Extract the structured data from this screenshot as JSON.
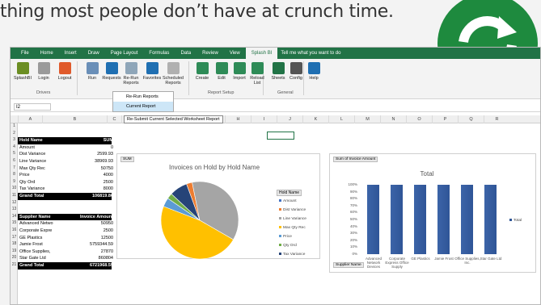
{
  "headline": "thing most people don’t have at crunch time.",
  "logo_icon": "refresh-arrows-icon",
  "ribbon": {
    "tabs": [
      "File",
      "Home",
      "Insert",
      "Draw",
      "Page Layout",
      "Formulas",
      "Data",
      "Review",
      "View",
      "Splash BI"
    ],
    "active_tab": "Splash BI",
    "tell_me": "Tell me what you want to do",
    "buttons": [
      {
        "label": "SplashBI",
        "icon": "splash-icon",
        "color": "#6b8e23"
      },
      {
        "label": "Login",
        "icon": "login-icon",
        "color": "#9a9a9a"
      },
      {
        "label": "Logout",
        "icon": "logout-icon",
        "color": "#e05a2b"
      },
      {
        "label": "Run",
        "icon": "run-icon",
        "color": "#6a8fb8"
      },
      {
        "label": "Requests",
        "icon": "requests-icon",
        "color": "#1f6fb2"
      },
      {
        "label": "Re-Run Reports",
        "icon": "rerun-icon",
        "color": "#8fa6b9"
      },
      {
        "label": "Favorites",
        "icon": "star-icon",
        "color": "#1f6fb2"
      },
      {
        "label": "Scheduled Reports",
        "icon": "calendar-icon",
        "color": "#b0b0b0"
      },
      {
        "label": "Create",
        "icon": "create-icon",
        "color": "#2e8b57"
      },
      {
        "label": "Edit",
        "icon": "edit-icon",
        "color": "#2e8b57"
      },
      {
        "label": "Import",
        "icon": "import-icon",
        "color": "#2e8b57"
      },
      {
        "label": "Reload List",
        "icon": "reload-icon",
        "color": "#2e8b57"
      },
      {
        "label": "Sheets",
        "icon": "sheets-icon",
        "color": "#217346"
      },
      {
        "label": "Config",
        "icon": "config-icon",
        "color": "#555555"
      },
      {
        "label": "Help",
        "icon": "help-icon",
        "color": "#1f6fb2"
      }
    ],
    "groups": [
      "Drivers",
      "Report Setup",
      "General"
    ]
  },
  "dropdown": {
    "items": [
      "Re-Run Reports",
      "Current Report"
    ],
    "selected": "Current Report"
  },
  "tooltip": "Re-Submit Current Selected Worksheet Report",
  "namebox": "I2",
  "columns": [
    "A",
    "B",
    "C",
    "D",
    "E",
    "F",
    "G",
    "H",
    "I",
    "J",
    "K",
    "L",
    "M",
    "N",
    "O",
    "P",
    "Q",
    "R"
  ],
  "rows": [
    "1",
    "2",
    "3",
    "4",
    "5",
    "6",
    "7",
    "8",
    "9",
    "10",
    "11",
    "12",
    "13",
    "14",
    "15",
    "16",
    "17",
    "18",
    "19",
    "20",
    "21"
  ],
  "table1": {
    "header": [
      "Hold Name",
      "SUM"
    ],
    "rows": [
      [
        "Amount",
        "0"
      ],
      [
        "Dist Variance",
        "2599.93"
      ],
      [
        "Line Variance",
        "38969.93"
      ],
      [
        "Max Qty Rec",
        "50750"
      ],
      [
        "Price",
        "4000"
      ],
      [
        "Qty Ord",
        "2500"
      ],
      [
        "Tax Variance",
        "8000"
      ]
    ],
    "total": [
      "Grand Total",
      "106819.86"
    ]
  },
  "table2": {
    "header": [
      "Supplier Name",
      "Invoice Amount"
    ],
    "rows": [
      [
        "Advanced Netwo",
        "50950"
      ],
      [
        "Corporate Expre",
        "2500"
      ],
      [
        "GE Plastics",
        "12500"
      ],
      [
        "Jamie Frost",
        "5759344.59"
      ],
      [
        "Office Supplies,",
        "27870"
      ],
      [
        "Star Gate Ltd",
        "860804"
      ]
    ],
    "total": [
      "Grand Total",
      "6721968.59"
    ]
  },
  "pie": {
    "field_tag": "SUM",
    "legend_header": "Hold Name",
    "chart_data": {
      "type": "pie",
      "title": "Invoices on Hold by Hold Name",
      "categories": [
        "Amount",
        "Dist Variance",
        "Line Variance",
        "Max Qty Rec",
        "Price",
        "Qty Ord",
        "Tax Variance"
      ],
      "values": [
        0,
        2599.93,
        38969.93,
        50750,
        4000,
        2500,
        8000
      ],
      "colors": [
        "#4472c4",
        "#ed7d31",
        "#a5a5a5",
        "#ffc000",
        "#5b9bd5",
        "#70ad47",
        "#264478"
      ]
    }
  },
  "bar": {
    "field_tag": "Sum of Invoice Amount",
    "axis_tag": "Supplier Name",
    "legend": "Total",
    "chart_data": {
      "type": "bar",
      "title": "Total",
      "categories": [
        "Advanced Network Devices",
        "Corporate Express Office Supply",
        "GE Plastics",
        "Jamie Frost",
        "Office Supplies, Inc.",
        "Star Gate Ltd"
      ],
      "values": [
        1.0,
        1.0,
        1.0,
        1.0,
        1.0,
        1.0
      ],
      "yticks": [
        "100%",
        "90%",
        "80%",
        "70%",
        "60%",
        "50%",
        "40%",
        "30%",
        "20%",
        "10%",
        "0%"
      ],
      "ylim": [
        0,
        1
      ],
      "color": "#2f5597"
    }
  }
}
